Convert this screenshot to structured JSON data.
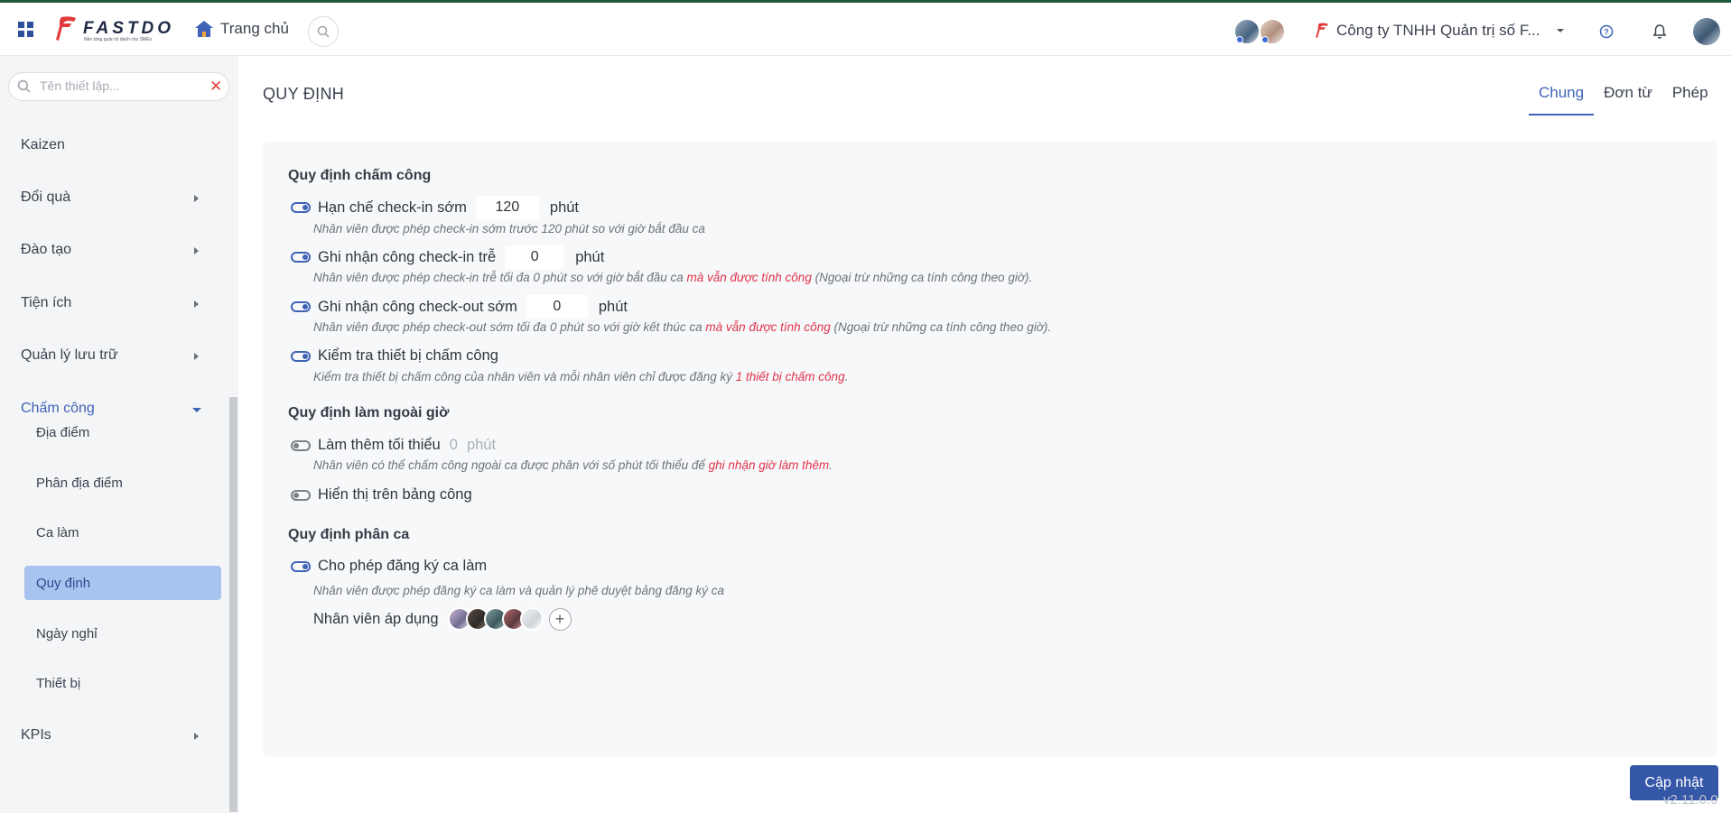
{
  "header": {
    "logo_text": "FASTDO",
    "logo_tagline": "Nền tảng quản trị dành cho SMEs",
    "home_label": "Trang chủ",
    "company_name": "Công ty TNHH Quản trị số F..."
  },
  "sidebar": {
    "search_placeholder": "Tên thiết lập...",
    "items": [
      {
        "label": "Kaizen"
      },
      {
        "label": "Đổi quà"
      },
      {
        "label": "Đào tạo"
      },
      {
        "label": "Tiện ích"
      },
      {
        "label": "Quản lý lưu trữ"
      },
      {
        "label": "Chấm công"
      },
      {
        "label": "KPIs"
      }
    ],
    "sub_items": [
      {
        "label": "Địa điểm"
      },
      {
        "label": "Phân địa điểm"
      },
      {
        "label": "Ca làm"
      },
      {
        "label": "Quy định"
      },
      {
        "label": "Ngày nghỉ"
      },
      {
        "label": "Thiết bị"
      }
    ]
  },
  "main": {
    "title": "QUY ĐỊNH",
    "tabs": [
      {
        "label": "Chung"
      },
      {
        "label": "Đơn từ"
      },
      {
        "label": "Phép"
      }
    ],
    "sections": {
      "attendance": "Quy định chấm công",
      "overtime": "Quy định làm ngoài giờ",
      "shift": "Quy định phân ca"
    },
    "rules": {
      "early_checkin": {
        "label": "Hạn chế check-in sớm",
        "value": "120",
        "unit": "phút",
        "desc": "Nhân viên được phép check-in sớm trước 120 phút so với giờ bắt đầu ca"
      },
      "late_checkin": {
        "label": "Ghi nhận công check-in trễ",
        "value": "0",
        "unit": "phút",
        "desc_a": "Nhân viên được phép check-in trễ tối đa 0 phút so với giờ bắt đầu ca ",
        "desc_hl": "mà vẫn được tính công",
        "desc_b": " (Ngoại trừ những ca tính công theo giờ)."
      },
      "early_checkout": {
        "label": "Ghi nhận công check-out sớm",
        "value": "0",
        "unit": "phút",
        "desc_a": "Nhân viên được phép check-out sớm tối đa 0 phút so với giờ kết thúc ca ",
        "desc_hl": "mà vẫn được tính công",
        "desc_b": " (Ngoại trừ những ca tính công theo giờ)."
      },
      "device_check": {
        "label": "Kiểm tra thiết bị chấm công",
        "desc_a": "Kiểm tra thiết bị chấm công của nhân viên và mỗi nhân viên chỉ được đăng ký ",
        "desc_hl": "1 thiết bị chấm công",
        "desc_b": "."
      },
      "overtime_min": {
        "label": "Làm thêm tối thiểu",
        "value": "0",
        "unit": "phút",
        "desc_a": "Nhân viên có thể chấm công ngoài ca được phân với số phút tối thiểu để ",
        "desc_hl": "ghi nhận giờ làm thêm",
        "desc_b": "."
      },
      "show_on_sheet": {
        "label": "Hiển thị trên bảng công"
      },
      "shift_register": {
        "label": "Cho phép đăng ký ca làm",
        "desc": "Nhân viên được phép đăng ký ca làm và quản lý phê duyệt bảng đăng ký ca"
      }
    },
    "employees_label": "Nhân viên áp dụng",
    "update_button": "Cập nhật",
    "version": "v2.11.0.0"
  },
  "colors": {
    "accent": "#3f63b6",
    "highlight": "#e0344d",
    "active_sidebar": "#a9c3f0",
    "button": "#3557a8"
  }
}
